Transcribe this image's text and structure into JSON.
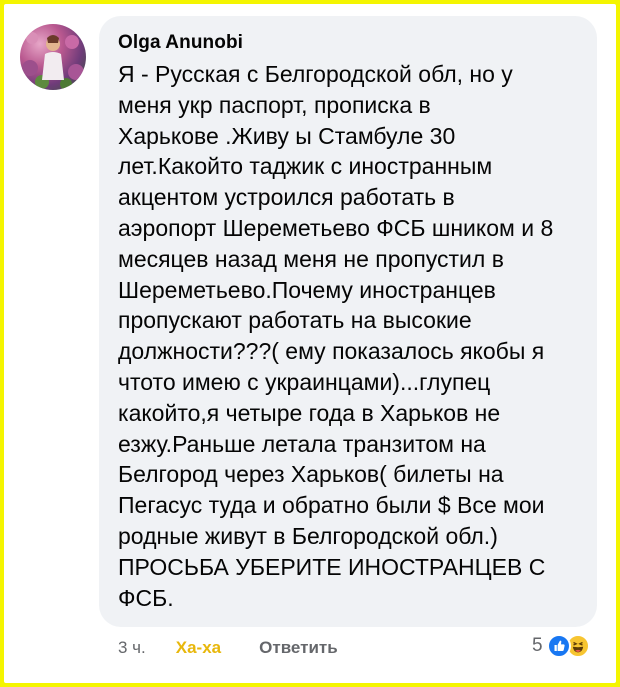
{
  "comment": {
    "author": "Olga Anunobi",
    "text_lines": [
      "Я - Русская с Белгородской обл, но у",
      "меня укр паспорт, прописка в",
      "Харькове .Живу ы Стамбуле 30",
      "лет.Какойто таджик с иностранным",
      "акцентом устроился работать в",
      "аэропорт Шереметьево ФСБ шником и 8",
      "месяцев назад меня не пропустил в",
      "Шереметьево.Почему иностранцев",
      "пропускают работать на высокие",
      "должности???( ему показалось якобы я",
      "чтото имею с украинцами)...глупец",
      "какойто,я четыре года в Харьков не",
      "езжу.Раньше летала транзитом на",
      "Белгород через Харьков( билеты на",
      "Пегасус туда и обратно были $ Все мои",
      "родные живут в Белгородской обл.)",
      "ПРОСЬБА УБЕРИТЕ ИНОСТРАНЦЕВ С",
      "ФСБ."
    ]
  },
  "actions": {
    "time": "3 ч.",
    "reaction_label": "Ха-ха",
    "reply_label": "Ответить"
  },
  "reactions": {
    "count": "5",
    "icons": [
      "like-icon",
      "haha-icon"
    ]
  },
  "colors": {
    "border": "#f4f500",
    "bubble": "#f0f2f5",
    "haha_active": "#e8b70b",
    "like_blue": "#1877f2",
    "secondary_text": "#65676b"
  }
}
